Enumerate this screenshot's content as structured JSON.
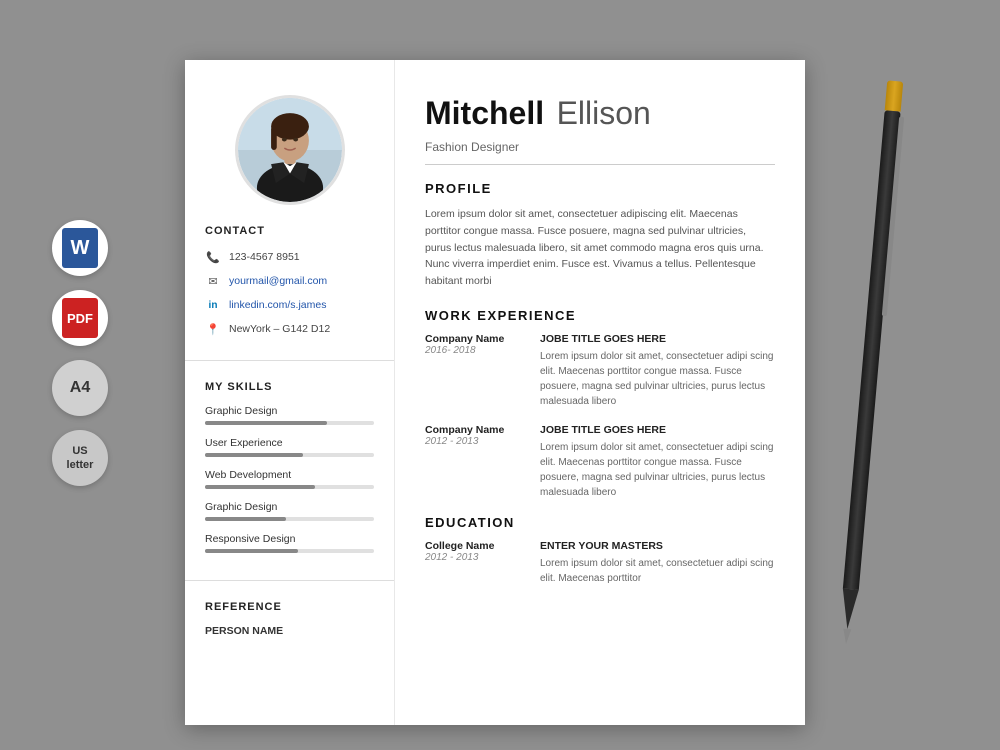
{
  "page": {
    "background_color": "#909090"
  },
  "left_icons": [
    {
      "id": "word",
      "label": "W",
      "type": "word"
    },
    {
      "id": "pdf",
      "label": "PDF",
      "type": "pdf"
    },
    {
      "id": "a4",
      "label": "A4",
      "type": "a4"
    },
    {
      "id": "us",
      "label": "US\nletter",
      "type": "us"
    }
  ],
  "resume": {
    "header": {
      "first_name": "Mitchell",
      "last_name": "Ellison",
      "job_title": "Fashion Designer"
    },
    "contact": {
      "section_title": "CONTACT",
      "phone": "123-4567 8951",
      "email": "yourmail@gmail.com",
      "linkedin": "linkedin.com/s.james",
      "address": "NewYork – G142 D12"
    },
    "skills": {
      "section_title": "MY SKILLS",
      "items": [
        {
          "name": "Graphic Design",
          "percent": 72
        },
        {
          "name": "User Experience",
          "percent": 58
        },
        {
          "name": "Web Development",
          "percent": 65
        },
        {
          "name": "Graphic Design",
          "percent": 48
        },
        {
          "name": "Responsive Design",
          "percent": 55
        }
      ]
    },
    "reference": {
      "section_title": "REFERENCE",
      "person_label": "PERSON NAME"
    },
    "profile": {
      "section_title": "PROFILE",
      "text": "Lorem ipsum dolor sit amet, consectetuer adipiscing elit. Maecenas porttitor congue massa. Fusce posuere, magna sed pulvinar ultricies, purus lectus malesuada libero, sit amet commodo magna eros quis urna. Nunc viverra imperdiet enim. Fusce est. Vivamus a tellus. Pellentesque habitant morbi"
    },
    "work_experience": {
      "section_title": "WORK EXPERIENCE",
      "items": [
        {
          "company": "Company Name",
          "years": "2016- 2018",
          "job_title": "JOBE TITLE GOES HERE",
          "description": "Lorem ipsum dolor sit amet, consectetuer adipi scing elit. Maecenas porttitor congue massa. Fusce posuere, magna sed pulvinar ultricies, purus lectus malesuada libero"
        },
        {
          "company": "Company Name",
          "years": "2012 - 2013",
          "job_title": "JOBE TITLE GOES HERE",
          "description": "Lorem ipsum dolor sit amet, consectetuer adipi scing elit. Maecenas porttitor congue massa. Fusce posuere, magna sed pulvinar ultricies, purus lectus malesuada libero"
        }
      ]
    },
    "education": {
      "section_title": "EDUCATION",
      "items": [
        {
          "college": "College Name",
          "years": "2012 - 2013",
          "degree": "ENTER YOUR MASTERS",
          "description": "Lorem ipsum dolor sit amet, consectetuer adipi scing elit. Maecenas porttitor"
        }
      ]
    }
  }
}
